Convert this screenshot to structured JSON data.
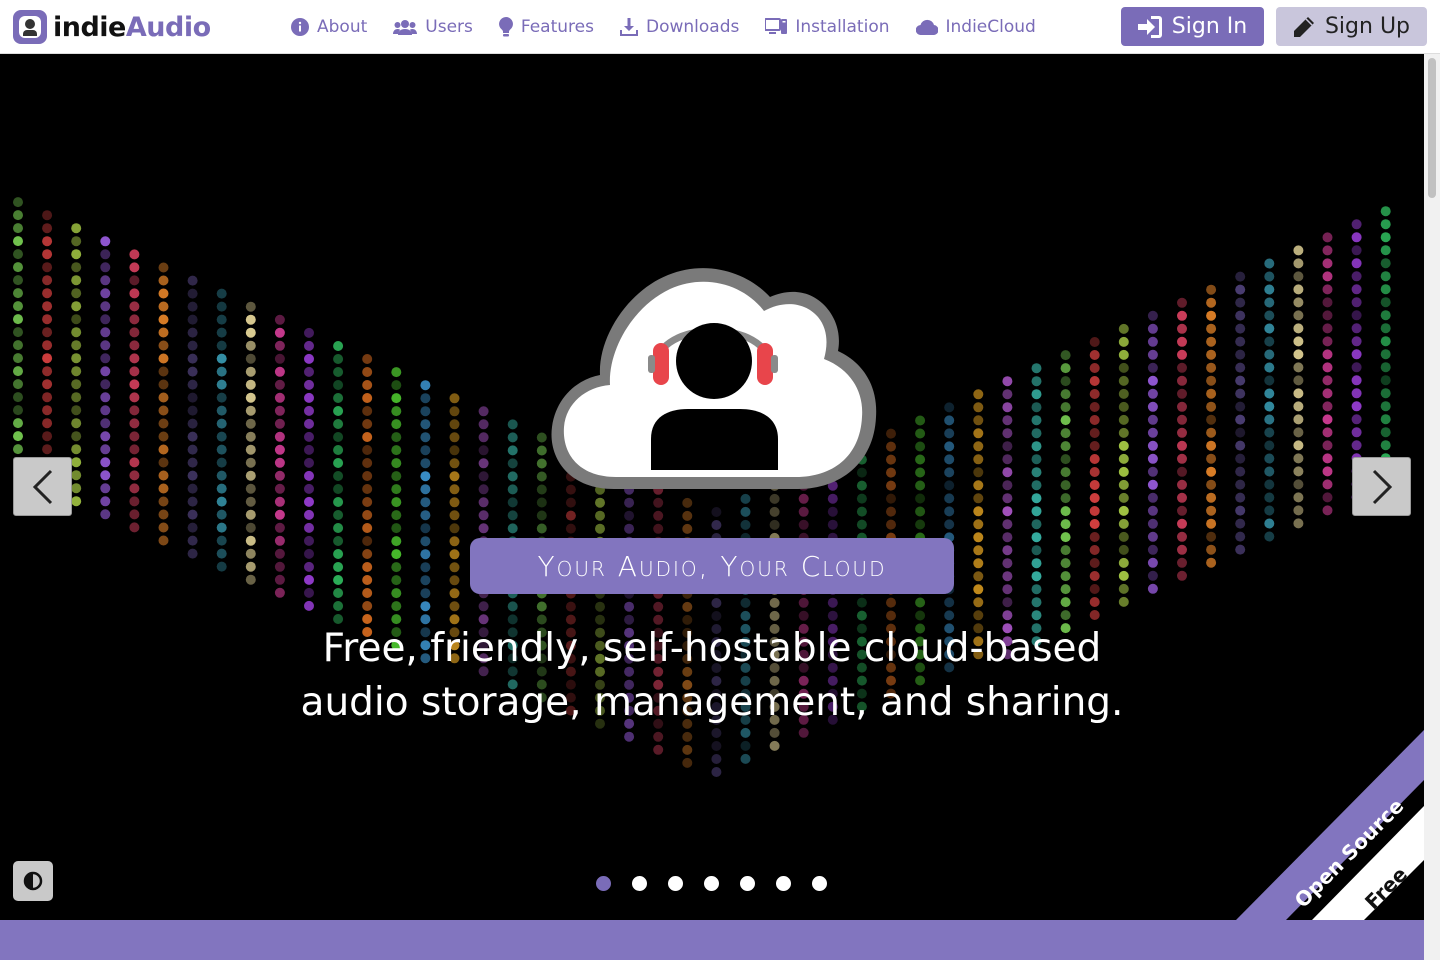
{
  "brand": {
    "name_part1": "indie",
    "name_part2": "Audio",
    "accent": "#7a6cb8"
  },
  "nav": {
    "items": [
      {
        "label": "About",
        "icon": "info-circle-icon"
      },
      {
        "label": "Users",
        "icon": "users-icon"
      },
      {
        "label": "Features",
        "icon": "lightbulb-icon"
      },
      {
        "label": "Downloads",
        "icon": "download-icon"
      },
      {
        "label": "Installation",
        "icon": "desktop-icon"
      },
      {
        "label": "IndieCloud",
        "icon": "cloud-icon"
      }
    ],
    "signin_label": "Sign In",
    "signup_label": "Sign Up"
  },
  "hero": {
    "pill_text": "Your Audio, Your Cloud",
    "tagline_line1": "Free, friendly, self-hostable cloud-based",
    "tagline_line2": "audio storage, management, and sharing.",
    "ribbon_top": "Open Source",
    "ribbon_bottom": "Free",
    "slide_count": 7,
    "active_slide": 1
  },
  "colors": {
    "accent": "#7a6cb8",
    "pill": "#8275bf",
    "headphone": "#e8454b"
  }
}
